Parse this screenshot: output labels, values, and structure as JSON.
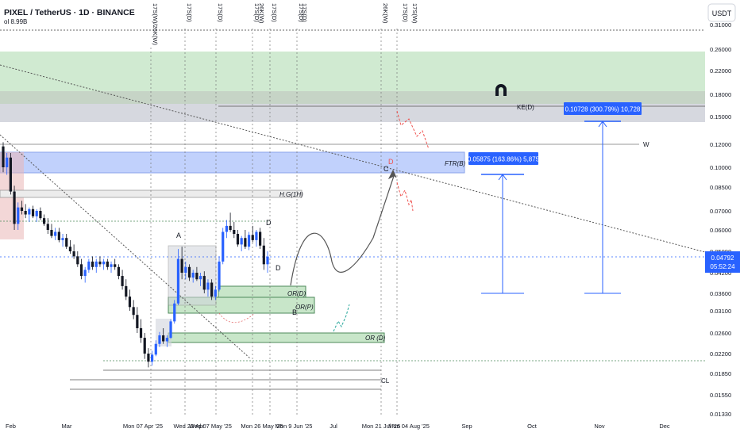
{
  "header": {
    "symbol_title": "PIXEL / TetherUS · 1D · BINANCE",
    "volume_label": "ol 8.99B",
    "currency_button": "USDT"
  },
  "price_axis": {
    "ticks": [
      "0.31000",
      "0.26000",
      "0.22000",
      "0.18000",
      "0.15000",
      "0.12000",
      "0.10000",
      "0.08500",
      "0.07000",
      "0.06000",
      "0.05000",
      "0.04200",
      "0.03600",
      "0.03100",
      "0.02600",
      "0.02200",
      "0.01850",
      "0.01550",
      "0.01330"
    ],
    "current_price": "0.04792",
    "countdown": "05:52:24"
  },
  "time_axis": {
    "ticks": [
      "Feb",
      "Mar",
      "Mon 07 Apr '25",
      "Wed 23 Apr",
      "Wed 07 May '25",
      "Mon 26 May '25",
      "Mon 9 Jun '25",
      "Jul",
      "Mon 21 Jul '25",
      "Mon 04 Aug '25",
      "Sep",
      "Oct",
      "Nov",
      "Dec"
    ]
  },
  "top_markers": [
    "17S(W)/26K(W)",
    "17S(D)",
    "17S(D)",
    "17S(D)",
    "26K(W)",
    "17S(D)",
    "17S(D)",
    "17S(D)",
    "26K(W)",
    "17S(D)",
    "17S(W)"
  ],
  "annotations": {
    "ke": "KE(D)",
    "ftr": "FTR(B)",
    "hg": "H.G(1H)",
    "ord": "OR(D)",
    "orp": "OR(P)",
    "or_d2": "OR (D)",
    "cl": "CL",
    "w": "W",
    "a": "A",
    "b": "B",
    "c": "C",
    "d_top": "D",
    "d_mid": "D",
    "d_red": "D"
  },
  "measure_labels": {
    "first": "0.05875 (163.86%) 5,875",
    "second": "0.10728 (300.79%) 10,728"
  },
  "colors": {
    "up_candle": "#2962ff",
    "down_candle": "#131722",
    "green_zone": "#c8e6c9",
    "grey_zone": "#d1d4dc",
    "blue_zone": "#bbcdfc",
    "label_blue": "#2962ff",
    "red_projection": "#ef5350",
    "current_price_tag": "#2962ff"
  },
  "chart_data": {
    "type": "candlestick",
    "title": "PIXEL / TetherUS · 1D · BINANCE",
    "xlabel": "",
    "ylabel": "",
    "scale": "log",
    "ylim": [
      0.0133,
      0.31
    ],
    "grid": false,
    "current_price": 0.04792,
    "zones": [
      {
        "label": "",
        "low": 0.195,
        "high": 0.26,
        "kind": "supply"
      },
      {
        "label": "KE(D)",
        "low": 0.15,
        "high": 0.178,
        "kind": "key-level"
      },
      {
        "label": "FTR(B)",
        "low": 0.098,
        "high": 0.117,
        "kind": "ftr"
      },
      {
        "label": "H.G(1H)",
        "low": 0.0825,
        "high": 0.0865,
        "kind": "gap"
      },
      {
        "label": "OR(D)",
        "low": 0.037,
        "high": 0.0395,
        "kind": "order-region"
      },
      {
        "label": "OR(P)",
        "low": 0.0335,
        "high": 0.037,
        "kind": "order-region"
      },
      {
        "label": "OR (D)",
        "low": 0.0242,
        "high": 0.0252,
        "kind": "order-region"
      }
    ],
    "measurements": [
      {
        "label": "0.05875 (163.86%) 5,875",
        "from": 0.0358,
        "to": 0.0945
      },
      {
        "label": "0.10728 (300.79%) 10,728",
        "from": 0.0357,
        "to": 0.143
      }
    ],
    "candles": [
      {
        "o": 0.118,
        "h": 0.122,
        "l": 0.096,
        "c": 0.1
      },
      {
        "o": 0.1,
        "h": 0.112,
        "l": 0.094,
        "c": 0.108
      },
      {
        "o": 0.108,
        "h": 0.112,
        "l": 0.08,
        "c": 0.082
      },
      {
        "o": 0.082,
        "h": 0.086,
        "l": 0.06,
        "c": 0.063
      },
      {
        "o": 0.063,
        "h": 0.075,
        "l": 0.06,
        "c": 0.072
      },
      {
        "o": 0.072,
        "h": 0.076,
        "l": 0.068,
        "c": 0.07
      },
      {
        "o": 0.07,
        "h": 0.074,
        "l": 0.066,
        "c": 0.068
      },
      {
        "o": 0.068,
        "h": 0.072,
        "l": 0.064,
        "c": 0.071
      },
      {
        "o": 0.071,
        "h": 0.073,
        "l": 0.066,
        "c": 0.067
      },
      {
        "o": 0.067,
        "h": 0.071,
        "l": 0.064,
        "c": 0.07
      },
      {
        "o": 0.07,
        "h": 0.072,
        "l": 0.065,
        "c": 0.066
      },
      {
        "o": 0.066,
        "h": 0.068,
        "l": 0.062,
        "c": 0.063
      },
      {
        "o": 0.063,
        "h": 0.066,
        "l": 0.058,
        "c": 0.06
      },
      {
        "o": 0.06,
        "h": 0.063,
        "l": 0.056,
        "c": 0.057
      },
      {
        "o": 0.057,
        "h": 0.061,
        "l": 0.055,
        "c": 0.059
      },
      {
        "o": 0.059,
        "h": 0.061,
        "l": 0.054,
        "c": 0.055
      },
      {
        "o": 0.055,
        "h": 0.058,
        "l": 0.052,
        "c": 0.056
      },
      {
        "o": 0.056,
        "h": 0.058,
        "l": 0.051,
        "c": 0.052
      },
      {
        "o": 0.052,
        "h": 0.055,
        "l": 0.049,
        "c": 0.05
      },
      {
        "o": 0.05,
        "h": 0.053,
        "l": 0.047,
        "c": 0.048
      },
      {
        "o": 0.048,
        "h": 0.05,
        "l": 0.044,
        "c": 0.045
      },
      {
        "o": 0.045,
        "h": 0.047,
        "l": 0.04,
        "c": 0.041
      },
      {
        "o": 0.041,
        "h": 0.044,
        "l": 0.039,
        "c": 0.043
      },
      {
        "o": 0.043,
        "h": 0.047,
        "l": 0.042,
        "c": 0.046
      },
      {
        "o": 0.046,
        "h": 0.048,
        "l": 0.043,
        "c": 0.044
      },
      {
        "o": 0.044,
        "h": 0.047,
        "l": 0.042,
        "c": 0.046
      },
      {
        "o": 0.046,
        "h": 0.048,
        "l": 0.044,
        "c": 0.045
      },
      {
        "o": 0.045,
        "h": 0.047,
        "l": 0.043,
        "c": 0.046
      },
      {
        "o": 0.046,
        "h": 0.047,
        "l": 0.043,
        "c": 0.044
      },
      {
        "o": 0.044,
        "h": 0.046,
        "l": 0.042,
        "c": 0.045
      },
      {
        "o": 0.045,
        "h": 0.047,
        "l": 0.043,
        "c": 0.044
      },
      {
        "o": 0.044,
        "h": 0.045,
        "l": 0.04,
        "c": 0.041
      },
      {
        "o": 0.041,
        "h": 0.043,
        "l": 0.037,
        "c": 0.038
      },
      {
        "o": 0.038,
        "h": 0.04,
        "l": 0.034,
        "c": 0.035
      },
      {
        "o": 0.035,
        "h": 0.037,
        "l": 0.031,
        "c": 0.032
      },
      {
        "o": 0.032,
        "h": 0.034,
        "l": 0.029,
        "c": 0.03
      },
      {
        "o": 0.03,
        "h": 0.032,
        "l": 0.026,
        "c": 0.027
      },
      {
        "o": 0.027,
        "h": 0.029,
        "l": 0.024,
        "c": 0.025
      },
      {
        "o": 0.025,
        "h": 0.026,
        "l": 0.021,
        "c": 0.022
      },
      {
        "o": 0.022,
        "h": 0.023,
        "l": 0.0195,
        "c": 0.0205
      },
      {
        "o": 0.0205,
        "h": 0.0225,
        "l": 0.0198,
        "c": 0.0218
      },
      {
        "o": 0.0218,
        "h": 0.0245,
        "l": 0.0215,
        "c": 0.0238
      },
      {
        "o": 0.0238,
        "h": 0.0262,
        "l": 0.0232,
        "c": 0.0255
      },
      {
        "o": 0.0255,
        "h": 0.027,
        "l": 0.0238,
        "c": 0.0243
      },
      {
        "o": 0.0243,
        "h": 0.0255,
        "l": 0.0232,
        "c": 0.025
      },
      {
        "o": 0.025,
        "h": 0.029,
        "l": 0.0248,
        "c": 0.0285
      },
      {
        "o": 0.0285,
        "h": 0.034,
        "l": 0.028,
        "c": 0.033
      },
      {
        "o": 0.033,
        "h": 0.051,
        "l": 0.0325,
        "c": 0.047
      },
      {
        "o": 0.047,
        "h": 0.052,
        "l": 0.04,
        "c": 0.042
      },
      {
        "o": 0.042,
        "h": 0.046,
        "l": 0.04,
        "c": 0.044
      },
      {
        "o": 0.044,
        "h": 0.045,
        "l": 0.0395,
        "c": 0.0405
      },
      {
        "o": 0.0405,
        "h": 0.043,
        "l": 0.039,
        "c": 0.042
      },
      {
        "o": 0.042,
        "h": 0.044,
        "l": 0.0395,
        "c": 0.04
      },
      {
        "o": 0.04,
        "h": 0.042,
        "l": 0.038,
        "c": 0.041
      },
      {
        "o": 0.041,
        "h": 0.0425,
        "l": 0.036,
        "c": 0.037
      },
      {
        "o": 0.037,
        "h": 0.04,
        "l": 0.035,
        "c": 0.039
      },
      {
        "o": 0.039,
        "h": 0.04,
        "l": 0.034,
        "c": 0.035
      },
      {
        "o": 0.035,
        "h": 0.038,
        "l": 0.034,
        "c": 0.037
      },
      {
        "o": 0.037,
        "h": 0.048,
        "l": 0.0365,
        "c": 0.046
      },
      {
        "o": 0.046,
        "h": 0.061,
        "l": 0.045,
        "c": 0.059
      },
      {
        "o": 0.059,
        "h": 0.065,
        "l": 0.056,
        "c": 0.062
      },
      {
        "o": 0.062,
        "h": 0.069,
        "l": 0.059,
        "c": 0.06
      },
      {
        "o": 0.06,
        "h": 0.064,
        "l": 0.056,
        "c": 0.058
      },
      {
        "o": 0.058,
        "h": 0.06,
        "l": 0.052,
        "c": 0.053
      },
      {
        "o": 0.053,
        "h": 0.057,
        "l": 0.05,
        "c": 0.056
      },
      {
        "o": 0.056,
        "h": 0.06,
        "l": 0.051,
        "c": 0.052
      },
      {
        "o": 0.052,
        "h": 0.059,
        "l": 0.0505,
        "c": 0.0575
      },
      {
        "o": 0.0575,
        "h": 0.062,
        "l": 0.054,
        "c": 0.055
      },
      {
        "o": 0.055,
        "h": 0.06,
        "l": 0.052,
        "c": 0.059
      },
      {
        "o": 0.059,
        "h": 0.061,
        "l": 0.051,
        "c": 0.0525
      },
      {
        "o": 0.0525,
        "h": 0.056,
        "l": 0.043,
        "c": 0.045
      },
      {
        "o": 0.045,
        "h": 0.05,
        "l": 0.042,
        "c": 0.0479
      }
    ]
  }
}
